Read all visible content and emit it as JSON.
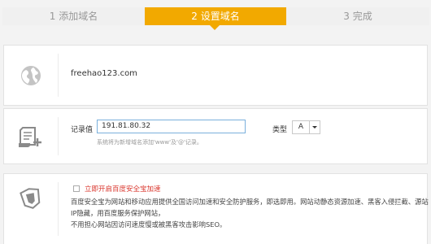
{
  "steps": [
    {
      "label": "1 添加域名",
      "state": "done"
    },
    {
      "label": "2 设置域名",
      "state": "active"
    },
    {
      "label": "3 完成",
      "state": "todo"
    }
  ],
  "colors": {
    "accent": "#f2a900",
    "warning_text": "#d9342b",
    "input_border": "#7ab0dc"
  },
  "domain_card": {
    "icon": "globe-icon",
    "domain": "freehao123.com"
  },
  "record_card": {
    "icon": "document-add-icon",
    "value_label": "记录值",
    "value": "191.81.80.32",
    "hint": "系统将为新增域名添加'www'及'@'记录。",
    "type_label": "类型",
    "type_value": "A"
  },
  "security_card": {
    "icon": "shield-icon",
    "checkbox_label": "立即开启百度安全宝加速",
    "checked": false,
    "desc_lines": [
      "百度安全宝为网站和移动应用提供全国访问加速和安全防护服务，即选即用。网站动静态资源加速、黑客入侵拦截、源站",
      "IP隐藏，用百度服务保护网站，",
      "不用担心网站因访问速度慢或被黑客攻击影响SEO。"
    ]
  }
}
